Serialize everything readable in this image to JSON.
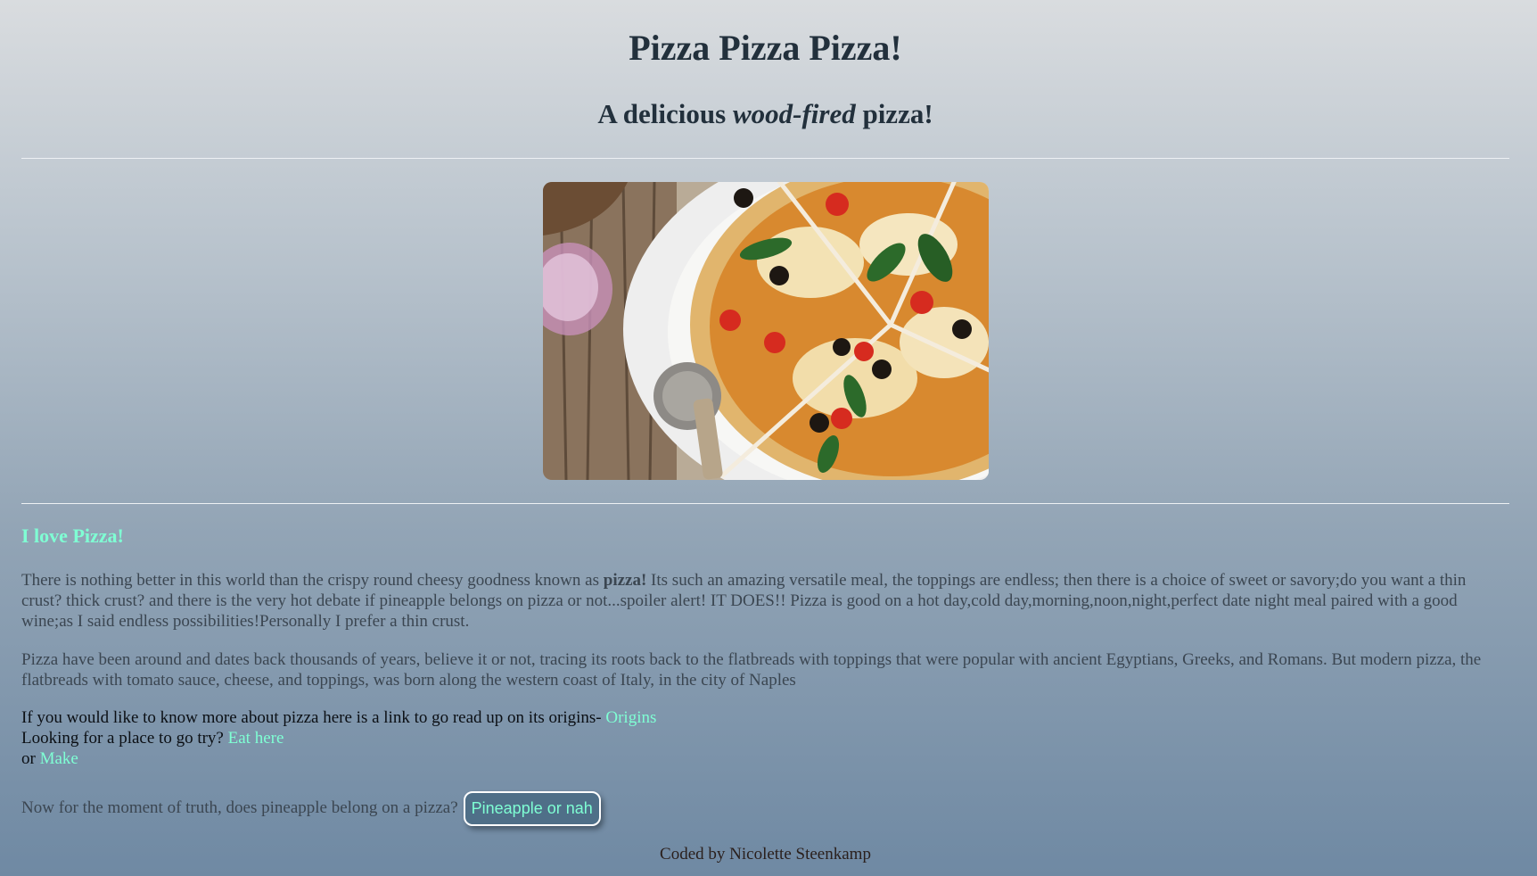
{
  "header": {
    "title": "Pizza Pizza Pizza!",
    "subtitle_before": "A delicious ",
    "subtitle_italic": "wood-fired",
    "subtitle_after": " pizza!"
  },
  "image": {
    "icon": "pizza-photo"
  },
  "section": {
    "heading": "I love Pizza!",
    "para1_before": "There is nothing better in this world than the crispy round cheesy goodness known as ",
    "para1_bold": "pizza!",
    "para1_after": " Its such an amazing versatile meal, the toppings are endless; then there is a choice of sweet or savory;do you want a thin crust? thick crust? and there is the very hot debate if pineapple belongs on pizza or not...spoiler alert! IT DOES!! Pizza is good on a hot day,cold day,morning,noon,night,perfect date night meal paired with a good wine;as I said endless possibilities!Personally I prefer a thin crust.",
    "para2": "Pizza have been around and dates back thousands of years, believe it or not, tracing its roots back to the flatbreads with toppings that were popular with ancient Egyptians, Greeks, and Romans. But modern pizza, the flatbreads with tomato sauce, cheese, and toppings, was born along the western coast of Italy, in the city of Naples"
  },
  "links": {
    "line1_text": "If you would like to know more about pizza here is a link to go read up on its origins- ",
    "origins_label": "Origins",
    "line2_text": "Looking for a place to go try? ",
    "eat_label": "Eat here",
    "line3_text": "or ",
    "make_label": "Make"
  },
  "truth": {
    "question": "Now for the moment of truth, does pineapple belong on a pizza?",
    "button_label": "Pineapple or nah"
  },
  "footer": {
    "credit": "Coded by Nicolette Steenkamp"
  },
  "colors": {
    "link": "#7fffd4",
    "heading": "#22303c",
    "text": "#3b4651"
  }
}
